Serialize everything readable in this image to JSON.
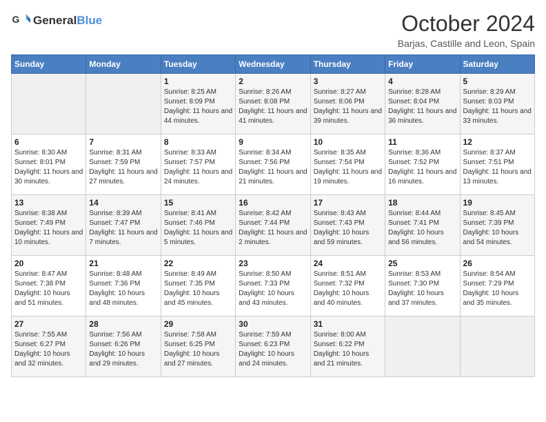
{
  "header": {
    "logo_general": "General",
    "logo_blue": "Blue",
    "month_title": "October 2024",
    "location": "Barjas, Castille and Leon, Spain"
  },
  "weekdays": [
    "Sunday",
    "Monday",
    "Tuesday",
    "Wednesday",
    "Thursday",
    "Friday",
    "Saturday"
  ],
  "weeks": [
    [
      {
        "day": "",
        "sunrise": "",
        "sunset": "",
        "daylight": ""
      },
      {
        "day": "",
        "sunrise": "",
        "sunset": "",
        "daylight": ""
      },
      {
        "day": "1",
        "sunrise": "Sunrise: 8:25 AM",
        "sunset": "Sunset: 8:09 PM",
        "daylight": "Daylight: 11 hours and 44 minutes."
      },
      {
        "day": "2",
        "sunrise": "Sunrise: 8:26 AM",
        "sunset": "Sunset: 8:08 PM",
        "daylight": "Daylight: 11 hours and 41 minutes."
      },
      {
        "day": "3",
        "sunrise": "Sunrise: 8:27 AM",
        "sunset": "Sunset: 8:06 PM",
        "daylight": "Daylight: 11 hours and 39 minutes."
      },
      {
        "day": "4",
        "sunrise": "Sunrise: 8:28 AM",
        "sunset": "Sunset: 8:04 PM",
        "daylight": "Daylight: 11 hours and 36 minutes."
      },
      {
        "day": "5",
        "sunrise": "Sunrise: 8:29 AM",
        "sunset": "Sunset: 8:03 PM",
        "daylight": "Daylight: 11 hours and 33 minutes."
      }
    ],
    [
      {
        "day": "6",
        "sunrise": "Sunrise: 8:30 AM",
        "sunset": "Sunset: 8:01 PM",
        "daylight": "Daylight: 11 hours and 30 minutes."
      },
      {
        "day": "7",
        "sunrise": "Sunrise: 8:31 AM",
        "sunset": "Sunset: 7:59 PM",
        "daylight": "Daylight: 11 hours and 27 minutes."
      },
      {
        "day": "8",
        "sunrise": "Sunrise: 8:33 AM",
        "sunset": "Sunset: 7:57 PM",
        "daylight": "Daylight: 11 hours and 24 minutes."
      },
      {
        "day": "9",
        "sunrise": "Sunrise: 8:34 AM",
        "sunset": "Sunset: 7:56 PM",
        "daylight": "Daylight: 11 hours and 21 minutes."
      },
      {
        "day": "10",
        "sunrise": "Sunrise: 8:35 AM",
        "sunset": "Sunset: 7:54 PM",
        "daylight": "Daylight: 11 hours and 19 minutes."
      },
      {
        "day": "11",
        "sunrise": "Sunrise: 8:36 AM",
        "sunset": "Sunset: 7:52 PM",
        "daylight": "Daylight: 11 hours and 16 minutes."
      },
      {
        "day": "12",
        "sunrise": "Sunrise: 8:37 AM",
        "sunset": "Sunset: 7:51 PM",
        "daylight": "Daylight: 11 hours and 13 minutes."
      }
    ],
    [
      {
        "day": "13",
        "sunrise": "Sunrise: 8:38 AM",
        "sunset": "Sunset: 7:49 PM",
        "daylight": "Daylight: 11 hours and 10 minutes."
      },
      {
        "day": "14",
        "sunrise": "Sunrise: 8:39 AM",
        "sunset": "Sunset: 7:47 PM",
        "daylight": "Daylight: 11 hours and 7 minutes."
      },
      {
        "day": "15",
        "sunrise": "Sunrise: 8:41 AM",
        "sunset": "Sunset: 7:46 PM",
        "daylight": "Daylight: 11 hours and 5 minutes."
      },
      {
        "day": "16",
        "sunrise": "Sunrise: 8:42 AM",
        "sunset": "Sunset: 7:44 PM",
        "daylight": "Daylight: 11 hours and 2 minutes."
      },
      {
        "day": "17",
        "sunrise": "Sunrise: 8:43 AM",
        "sunset": "Sunset: 7:43 PM",
        "daylight": "Daylight: 10 hours and 59 minutes."
      },
      {
        "day": "18",
        "sunrise": "Sunrise: 8:44 AM",
        "sunset": "Sunset: 7:41 PM",
        "daylight": "Daylight: 10 hours and 56 minutes."
      },
      {
        "day": "19",
        "sunrise": "Sunrise: 8:45 AM",
        "sunset": "Sunset: 7:39 PM",
        "daylight": "Daylight: 10 hours and 54 minutes."
      }
    ],
    [
      {
        "day": "20",
        "sunrise": "Sunrise: 8:47 AM",
        "sunset": "Sunset: 7:38 PM",
        "daylight": "Daylight: 10 hours and 51 minutes."
      },
      {
        "day": "21",
        "sunrise": "Sunrise: 8:48 AM",
        "sunset": "Sunset: 7:36 PM",
        "daylight": "Daylight: 10 hours and 48 minutes."
      },
      {
        "day": "22",
        "sunrise": "Sunrise: 8:49 AM",
        "sunset": "Sunset: 7:35 PM",
        "daylight": "Daylight: 10 hours and 45 minutes."
      },
      {
        "day": "23",
        "sunrise": "Sunrise: 8:50 AM",
        "sunset": "Sunset: 7:33 PM",
        "daylight": "Daylight: 10 hours and 43 minutes."
      },
      {
        "day": "24",
        "sunrise": "Sunrise: 8:51 AM",
        "sunset": "Sunset: 7:32 PM",
        "daylight": "Daylight: 10 hours and 40 minutes."
      },
      {
        "day": "25",
        "sunrise": "Sunrise: 8:53 AM",
        "sunset": "Sunset: 7:30 PM",
        "daylight": "Daylight: 10 hours and 37 minutes."
      },
      {
        "day": "26",
        "sunrise": "Sunrise: 8:54 AM",
        "sunset": "Sunset: 7:29 PM",
        "daylight": "Daylight: 10 hours and 35 minutes."
      }
    ],
    [
      {
        "day": "27",
        "sunrise": "Sunrise: 7:55 AM",
        "sunset": "Sunset: 6:27 PM",
        "daylight": "Daylight: 10 hours and 32 minutes."
      },
      {
        "day": "28",
        "sunrise": "Sunrise: 7:56 AM",
        "sunset": "Sunset: 6:26 PM",
        "daylight": "Daylight: 10 hours and 29 minutes."
      },
      {
        "day": "29",
        "sunrise": "Sunrise: 7:58 AM",
        "sunset": "Sunset: 6:25 PM",
        "daylight": "Daylight: 10 hours and 27 minutes."
      },
      {
        "day": "30",
        "sunrise": "Sunrise: 7:59 AM",
        "sunset": "Sunset: 6:23 PM",
        "daylight": "Daylight: 10 hours and 24 minutes."
      },
      {
        "day": "31",
        "sunrise": "Sunrise: 8:00 AM",
        "sunset": "Sunset: 6:22 PM",
        "daylight": "Daylight: 10 hours and 21 minutes."
      },
      {
        "day": "",
        "sunrise": "",
        "sunset": "",
        "daylight": ""
      },
      {
        "day": "",
        "sunrise": "",
        "sunset": "",
        "daylight": ""
      }
    ]
  ]
}
